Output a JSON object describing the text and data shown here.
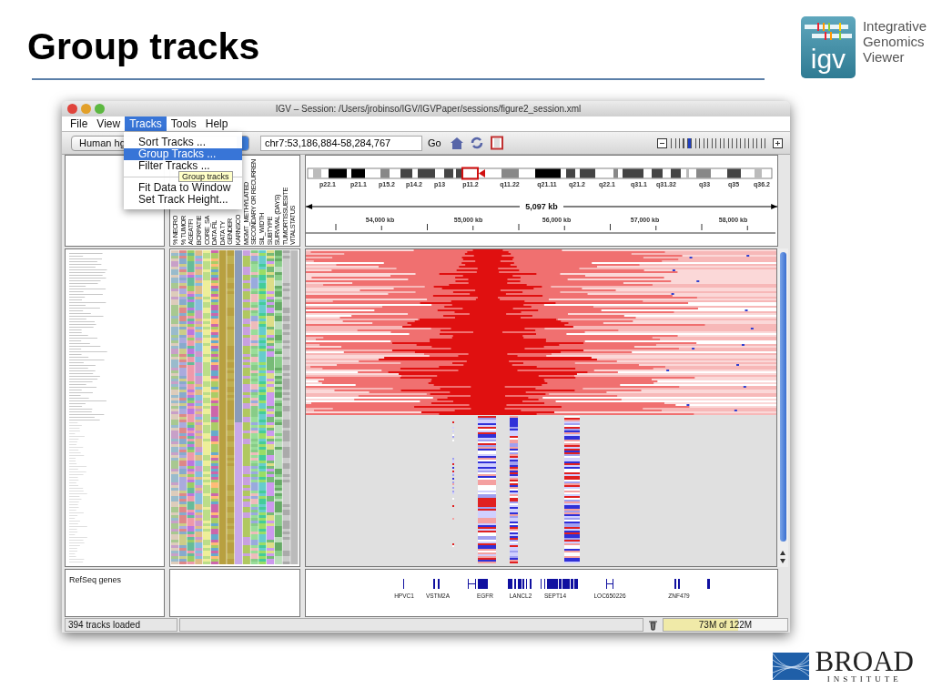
{
  "slide": {
    "title": "Group tracks"
  },
  "igv_logo": {
    "mark": "igv",
    "lines": [
      "Integrative",
      "Genomics",
      "Viewer"
    ]
  },
  "broad_logo": {
    "name": "BROAD",
    "subtitle": "INSTITUTE"
  },
  "window": {
    "title": "IGV – Session: /Users/jrobinso/IGV/IGVPaper/sessions/figure2_session.xml"
  },
  "menu_bar": [
    {
      "label": "File",
      "selected": false
    },
    {
      "label": "View",
      "selected": false
    },
    {
      "label": "Tracks",
      "selected": true
    },
    {
      "label": "Tools",
      "selected": false
    },
    {
      "label": "Help",
      "selected": false
    }
  ],
  "open_menu": [
    {
      "kind": "item",
      "label": "Sort Tracks ...",
      "selected": false
    },
    {
      "kind": "item",
      "label": "Group Tracks  ...",
      "selected": true
    },
    {
      "kind": "item",
      "label": "Filter Tracks ...",
      "selected": false
    },
    {
      "kind": "separator"
    },
    {
      "kind": "item",
      "label": "Fit Data to Window",
      "selected": false
    },
    {
      "kind": "item",
      "label": "Set Track Height...",
      "selected": false
    }
  ],
  "tooltip": "Group tracks",
  "toolbar": {
    "genome": "Human hg",
    "locus": "chr7:53,186,884-58,284,767",
    "go": "Go",
    "zoom": {
      "level": 0.18
    }
  },
  "attribute_headers": [
    "% NECRO",
    "% TUMOR",
    "AGEATFI",
    "BCRPATIE",
    "CORE_SA",
    "DATA FIL",
    "DATA TY",
    "GENDER",
    "KARNSCO",
    "MGMT_METHYLATED",
    "SECONDARY OR RECURREN",
    "SIL_WIDTH",
    "SUBTYPE",
    "SURVIVAL (DAYS)",
    "TUMORTISSUESITE",
    "VITALSTATUS"
  ],
  "ideogram": {
    "bands": [
      "p22.1",
      "p21.1",
      "p15.2",
      "p14.2",
      "p13",
      "p11.2",
      "q11.22",
      "q21.11",
      "q21.2",
      "q22.1",
      "q31.1",
      "q31.32",
      "q33",
      "q35",
      "q36.2"
    ]
  },
  "ruler": {
    "span": "5,097 kb",
    "ticks": [
      "54,000 kb",
      "55,000 kb",
      "56,000 kb",
      "57,000 kb",
      "58,000 kb"
    ]
  },
  "feature_track": {
    "name": "RefSeq genes",
    "genes": [
      "HPVC1",
      "VSTM2A",
      "EGFR",
      "LANCL2",
      "SEPT14",
      "LOC650226",
      "ZNF479"
    ]
  },
  "status_bar": {
    "message": "394 tracks loaded",
    "memory": {
      "reading": "73M of 122M",
      "level": 0.6
    }
  }
}
